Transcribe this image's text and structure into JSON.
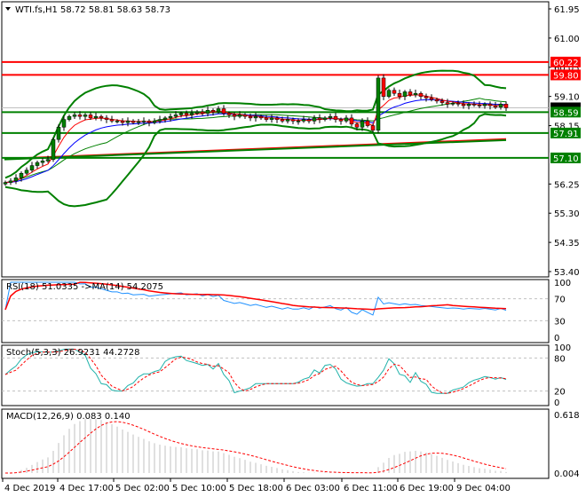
{
  "header": {
    "symbol": "WTI.fs,H1",
    "ohlc": "58.72 58.81 58.63 58.73",
    "menu_icon": "triangle-down-icon"
  },
  "colors": {
    "bull": "#008000",
    "bear": "#ff0000",
    "band": "#008000",
    "ma_fast": "#ff0000",
    "ma_slow": "#0000ff",
    "rsi": "#1e90ff",
    "stoch_main": "#20b2aa",
    "signal": "#ff0000",
    "hist": "#c0c0c0"
  },
  "chart_data": {
    "type": "candlestick",
    "title": "WTI.fs,H1",
    "price_axis": {
      "ylim": [
        53.4,
        61.95
      ],
      "ticks": [
        "61.95",
        "61.00",
        "60.05",
        "59.10",
        "58.15",
        "56.25",
        "55.30",
        "54.35",
        "53.40"
      ]
    },
    "time_axis": {
      "ticks": [
        "4 Dec 2019",
        "4 Dec 17:00",
        "5 Dec 02:00",
        "5 Dec 10:00",
        "5 Dec 18:00",
        "6 Dec 03:00",
        "6 Dec 11:00",
        "6 Dec 19:00",
        "9 Dec 04:00"
      ]
    },
    "closes": [
      56.3,
      56.35,
      56.45,
      56.6,
      56.7,
      56.85,
      56.95,
      57.0,
      57.05,
      57.7,
      58.1,
      58.35,
      58.45,
      58.5,
      58.45,
      58.5,
      58.4,
      58.45,
      58.4,
      58.35,
      58.3,
      58.3,
      58.25,
      58.3,
      58.25,
      58.28,
      58.3,
      58.25,
      58.3,
      58.35,
      58.4,
      58.45,
      58.5,
      58.55,
      58.5,
      58.55,
      58.6,
      58.55,
      58.65,
      58.6,
      58.7,
      58.55,
      58.5,
      58.45,
      58.5,
      58.45,
      58.4,
      58.45,
      58.4,
      58.35,
      58.4,
      58.35,
      58.3,
      58.35,
      58.3,
      58.3,
      58.35,
      58.3,
      58.4,
      58.35,
      58.4,
      58.45,
      58.35,
      58.3,
      58.4,
      58.2,
      58.1,
      58.3,
      58.15,
      58.0,
      59.7,
      59.1,
      59.3,
      59.2,
      59.1,
      59.25,
      59.15,
      59.2,
      59.1,
      59.05,
      59.0,
      58.95,
      58.9,
      58.85,
      58.88,
      58.85,
      58.8,
      58.85,
      58.82,
      58.8,
      58.85,
      58.8,
      58.75,
      58.85,
      58.73
    ],
    "levels": [
      {
        "value": 60.22,
        "label": "60.22",
        "color": "#ff0000"
      },
      {
        "value": 59.8,
        "label": "59.80",
        "color": "#ff0000"
      },
      {
        "value": 58.59,
        "label": "58.59",
        "color": "#008000"
      },
      {
        "value": 57.91,
        "label": "57.91",
        "color": "#008000"
      },
      {
        "value": 57.1,
        "label": "57.10",
        "color": "#008000"
      }
    ],
    "current_price": 58.73,
    "trendlines": [
      {
        "from": 57.07,
        "to": 57.71,
        "color": "#ff0000"
      },
      {
        "from": 57.05,
        "to": 57.68,
        "color": "#008000"
      }
    ],
    "indicators": {
      "rsi": {
        "label": "RSI(18) 51.0335  ->MA(14) 54.2075",
        "ticks": [
          "100",
          "70",
          "30",
          "0"
        ],
        "levels": [
          70,
          30
        ]
      },
      "stoch": {
        "label": "Stoch(5,3,3) 26.9231 44.2728",
        "ticks": [
          "100",
          "80",
          "20",
          "0"
        ],
        "levels": [
          80,
          20
        ]
      },
      "macd": {
        "label": "MACD(12,26,9) 0.083 0.140",
        "ticks": [
          "0.618",
          "0.004"
        ],
        "range": [
          0.004,
          0.618
        ]
      }
    }
  }
}
